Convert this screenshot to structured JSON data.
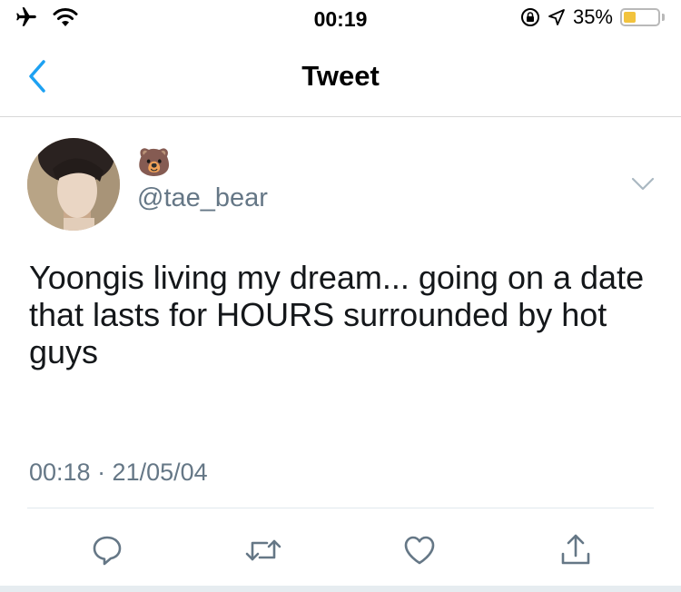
{
  "status_bar": {
    "time": "00:19",
    "battery_percent_label": "35%",
    "battery_level": 0.35,
    "icons": [
      "airplane-icon",
      "wifi-icon",
      "rotation-lock-icon",
      "location-icon",
      "battery-icon"
    ],
    "battery_color": "#f2c33d"
  },
  "header": {
    "title": "Tweet",
    "accent_color": "#1da1f2"
  },
  "tweet": {
    "display_name": "🐻",
    "handle": "@tae_bear",
    "text": "Yoongis living my dream... going on a date that lasts for HOURS surrounded by hot guys",
    "timestamp": "00:18 · 21/05/04"
  },
  "actions": {
    "icons": [
      "reply-icon",
      "retweet-icon",
      "like-icon",
      "share-icon"
    ],
    "icon_color": "#657786"
  }
}
